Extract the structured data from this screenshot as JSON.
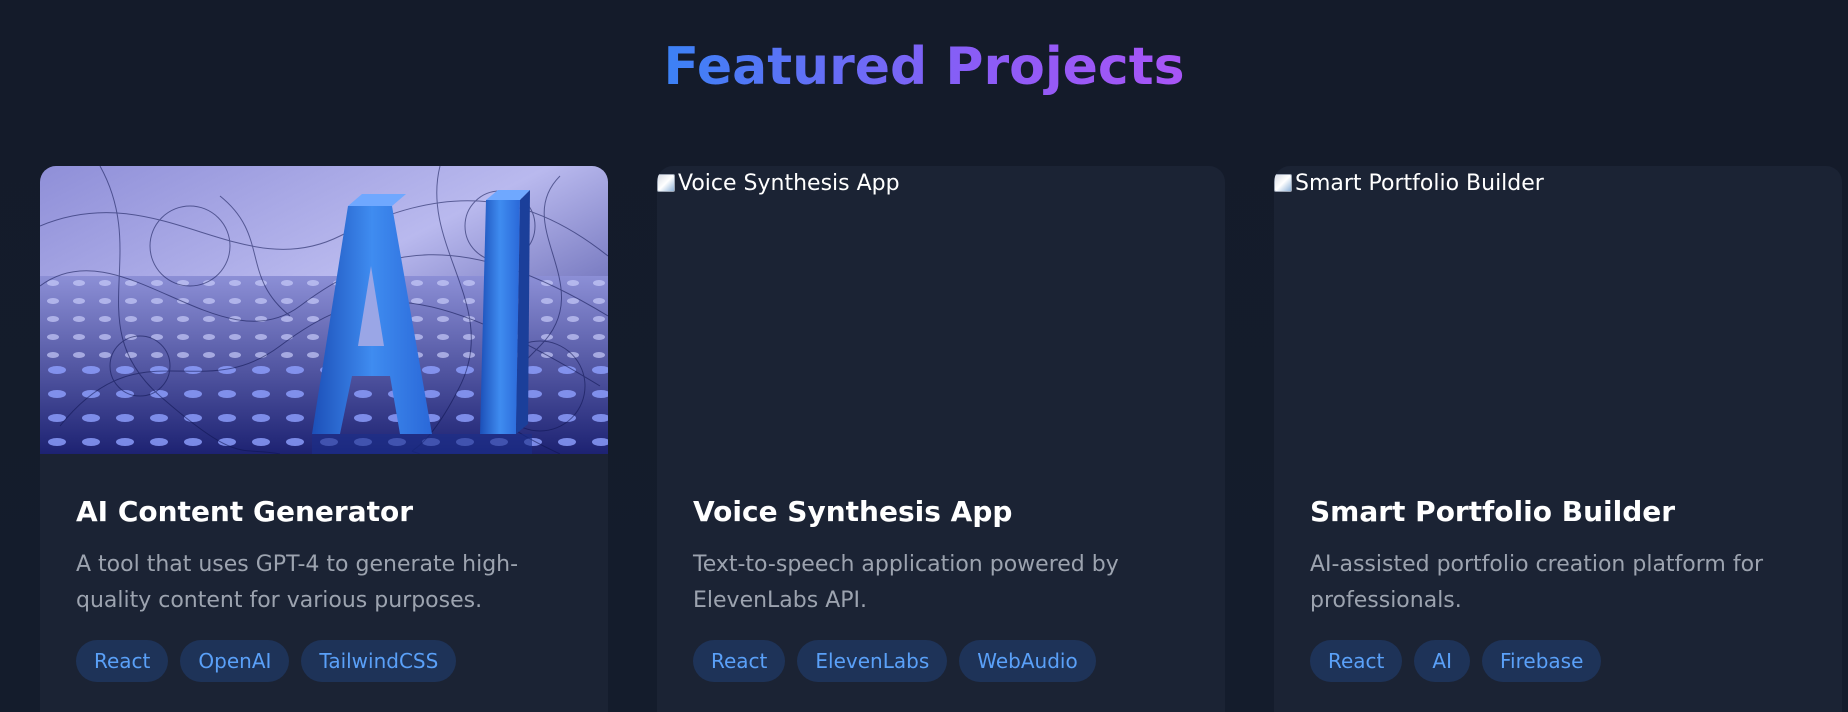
{
  "section": {
    "title": "Featured Projects"
  },
  "projects": [
    {
      "title": "AI Content Generator",
      "description": "A tool that uses GPT-4 to generate high-quality content for various purposes.",
      "image_alt": "",
      "image_state": "loaded",
      "image_text": "AI",
      "tags": [
        "React",
        "OpenAI",
        "TailwindCSS"
      ]
    },
    {
      "title": "Voice Synthesis App",
      "description": "Text-to-speech application powered by ElevenLabs API.",
      "image_alt": "Voice Synthesis App",
      "image_state": "broken",
      "tags": [
        "React",
        "ElevenLabs",
        "WebAudio"
      ]
    },
    {
      "title": "Smart Portfolio Builder",
      "description": "AI-assisted portfolio creation platform for professionals.",
      "image_alt": "Smart Portfolio Builder",
      "image_state": "broken",
      "tags": [
        "React",
        "AI",
        "Firebase"
      ]
    }
  ],
  "colors": {
    "background": "#141b2a",
    "card": "#1b2334",
    "title_gradient_start": "#3b82f6",
    "title_gradient_end": "#a855f7",
    "tag_bg": "#1e3358",
    "tag_text": "#5aa0f8",
    "description": "#9ca3af"
  },
  "icons": {
    "broken_image": "broken-image-icon"
  }
}
